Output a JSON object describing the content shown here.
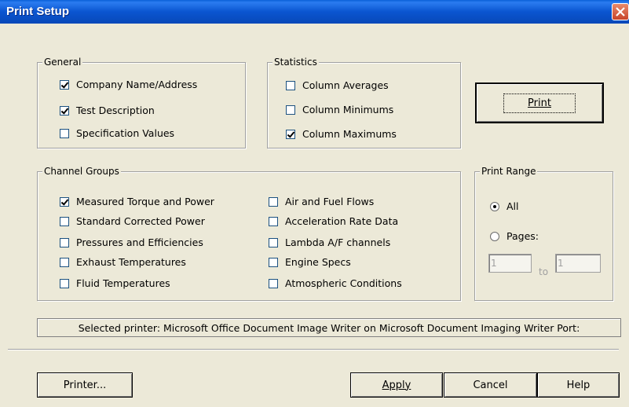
{
  "window": {
    "title": "Print Setup"
  },
  "general": {
    "title": "General",
    "items": [
      {
        "label": "Company Name/Address",
        "checked": true
      },
      {
        "label": "Test Description",
        "checked": true
      },
      {
        "label": "Specification Values",
        "checked": false
      }
    ]
  },
  "statistics": {
    "title": "Statistics",
    "items": [
      {
        "label": "Column Averages",
        "checked": false
      },
      {
        "label": "Column Minimums",
        "checked": false
      },
      {
        "label": "Column Maximums",
        "checked": true
      }
    ]
  },
  "channel_groups": {
    "title": "Channel Groups",
    "items": [
      {
        "label": "Measured Torque and Power",
        "checked": true
      },
      {
        "label": "Standard Corrected Power",
        "checked": false
      },
      {
        "label": "Pressures and Efficiencies",
        "checked": false
      },
      {
        "label": "Exhaust Temperatures",
        "checked": false
      },
      {
        "label": "Fluid Temperatures",
        "checked": false
      },
      {
        "label": "Air and Fuel Flows",
        "checked": false
      },
      {
        "label": "Acceleration Rate Data",
        "checked": false
      },
      {
        "label": "Lambda A/F channels",
        "checked": false
      },
      {
        "label": "Engine Specs",
        "checked": false
      },
      {
        "label": "Atmospheric Conditions",
        "checked": false
      }
    ]
  },
  "print_range": {
    "title": "Print Range",
    "all_label": "All",
    "pages_label": "Pages:",
    "selected": "All",
    "from": "1",
    "to_label": "to",
    "to": "1"
  },
  "buttons": {
    "print": "Print",
    "printer": "Printer...",
    "apply": "Apply",
    "cancel": "Cancel",
    "help": "Help"
  },
  "status": "Selected printer: Microsoft Office Document Image Writer on Microsoft Document Imaging Writer Port:",
  "colors": {
    "titlebar": "#0a55d0",
    "face": "#ece9d8",
    "close": "#c8452a"
  }
}
